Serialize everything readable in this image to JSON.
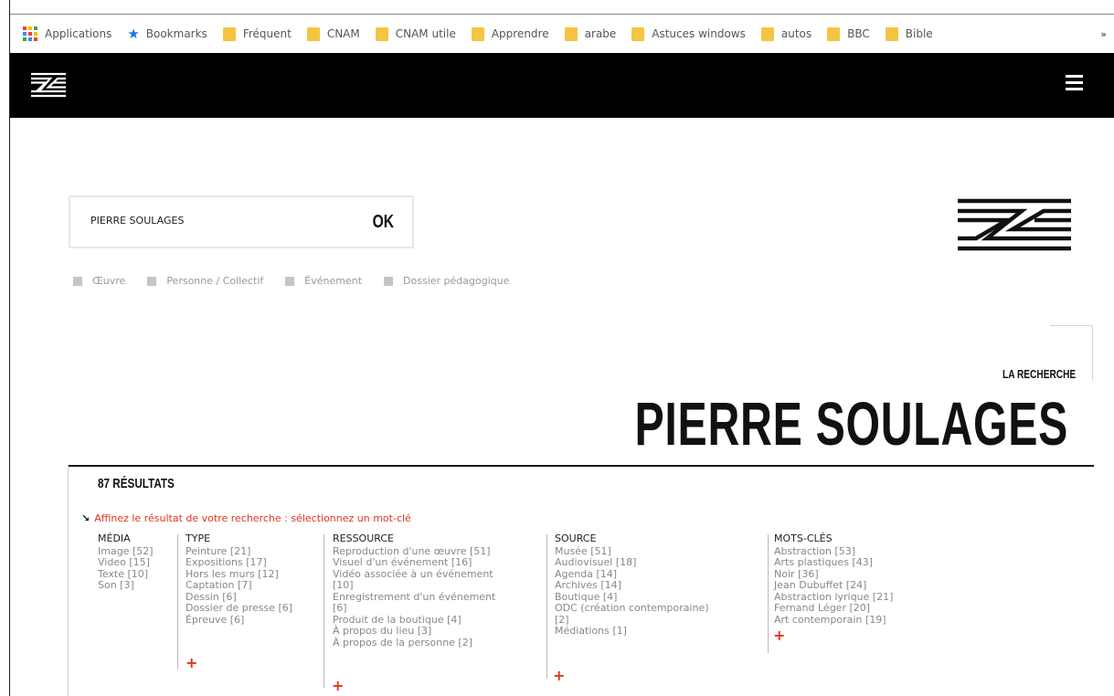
{
  "bookmarks": {
    "items": [
      {
        "label": "Applications",
        "icon": "apps-grid-icon"
      },
      {
        "label": "Bookmarks",
        "icon": "star-icon"
      },
      {
        "label": "Fréquent",
        "icon": "folder-icon"
      },
      {
        "label": "CNAM",
        "icon": "folder-icon"
      },
      {
        "label": "CNAM utile",
        "icon": "folder-icon"
      },
      {
        "label": "Apprendre",
        "icon": "folder-icon"
      },
      {
        "label": "arabe",
        "icon": "folder-icon"
      },
      {
        "label": "Astuces windows",
        "icon": "folder-icon"
      },
      {
        "label": "autos",
        "icon": "folder-icon"
      },
      {
        "label": "BBC",
        "icon": "folder-icon"
      },
      {
        "label": "Bible",
        "icon": "folder-icon"
      }
    ],
    "more": "»"
  },
  "header": {
    "logo_icon": "logo-icon",
    "menu_icon": "hamburger-icon"
  },
  "search": {
    "value": "PIERRE SOULAGES",
    "ok_label": "OK"
  },
  "filters": [
    "Œuvre",
    "Personne / Collectif",
    "Événement",
    "Dossier pédagogique"
  ],
  "tab": {
    "label": "LA RECHERCHE"
  },
  "title": "PIERRE SOULAGES",
  "results_label": "87 RÉSULTATS",
  "refine_text": "Affinez le résultat de votre recherche : sélectionnez un mot-clé",
  "colors": {
    "accent": "#e2341d",
    "header_bg": "#000000",
    "folder": "#f5c542",
    "star": "#1a73e8"
  },
  "facets": {
    "media": {
      "title": "MÉDIA",
      "items": [
        "Image [52]",
        "Video [15]",
        "Texte [10]",
        "Son [3]"
      ]
    },
    "type": {
      "title": "TYPE",
      "items": [
        "Peinture [21]",
        "Expositions [17]",
        "Hors les murs [12]",
        "Captation [7]",
        "Dessin [6]",
        "Dossier de presse [6]",
        "Épreuve [6]"
      ]
    },
    "ressource": {
      "title": "RESSOURCE",
      "items": [
        "Reproduction d'une œuvre [51]",
        "Visuel d'un événement [16]",
        "Vidéo associée à un événement",
        "[10]",
        "Enregistrement d'un événement",
        "[6]",
        "Produit de la boutique [4]",
        "À propos du lieu [3]",
        "À propos de la personne [2]"
      ]
    },
    "source": {
      "title": "SOURCE",
      "items": [
        "Musée [51]",
        "Audiovisuel [18]",
        "Agenda [14]",
        "Archives [14]",
        "Boutique [4]",
        "ODC (création contemporaine)",
        "[2]",
        "Médiations [1]"
      ]
    },
    "motscles": {
      "title": "MOTS-CLÉS",
      "items": [
        "Abstraction [53]",
        "Arts plastiques [43]",
        "Noir [36]",
        "Jean Dubuffet [24]",
        "Abstraction lyrique [21]",
        "Fernand Léger [20]",
        "Art contemporain [19]"
      ]
    }
  },
  "more_label": "+"
}
